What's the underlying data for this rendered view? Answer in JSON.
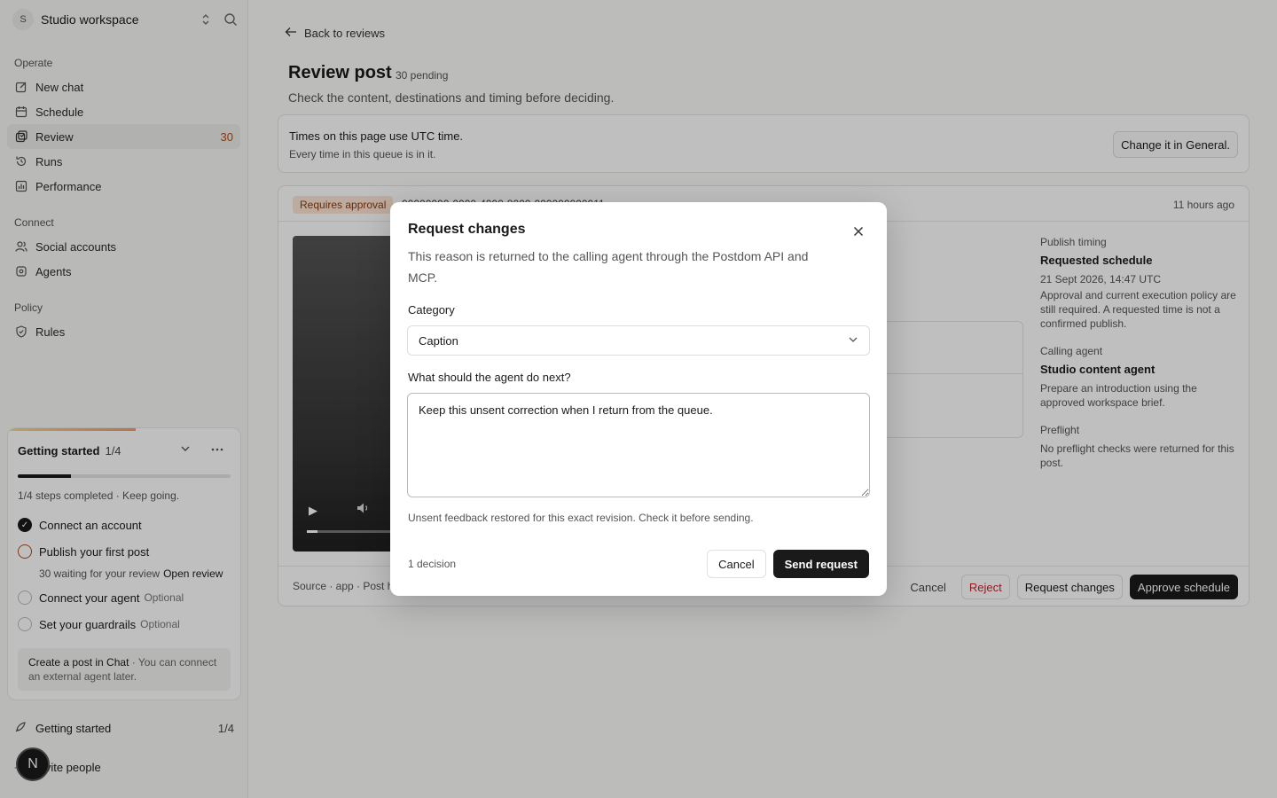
{
  "sidebar": {
    "workspace": {
      "initial": "S",
      "name": "Studio workspace"
    },
    "sections": [
      {
        "label": "Operate",
        "items": [
          {
            "label": "New chat",
            "icon": "pencil-icon"
          },
          {
            "label": "Schedule",
            "icon": "calendar-icon"
          },
          {
            "label": "Review",
            "icon": "review-icon",
            "count": "30",
            "active": true
          },
          {
            "label": "Runs",
            "icon": "history-icon"
          },
          {
            "label": "Performance",
            "icon": "bar-chart-icon"
          }
        ]
      },
      {
        "label": "Connect",
        "items": [
          {
            "label": "Social accounts",
            "icon": "users-icon"
          },
          {
            "label": "Agents",
            "icon": "bot-icon"
          }
        ]
      },
      {
        "label": "Policy",
        "items": [
          {
            "label": "Rules",
            "icon": "shield-icon"
          }
        ]
      }
    ],
    "getting_started": {
      "title": "Getting started",
      "fraction": "1/4",
      "progress": 0.25,
      "subtitle": "1/4 steps completed · Keep going.",
      "steps": [
        {
          "label": "Connect an account",
          "status": "done",
          "optional": ""
        },
        {
          "label": "Publish your first post",
          "status": "current",
          "optional": ""
        },
        {
          "label": "Connect your agent",
          "status": "todo",
          "optional": "Optional"
        },
        {
          "label": "Set your guardrails",
          "status": "todo",
          "optional": "Optional"
        }
      ],
      "waiting_text": "30 waiting for your review",
      "waiting_link": "Open review",
      "hint_strong": "Create a post in Chat",
      "hint_rest": " · You can connect an external agent later."
    },
    "bottom": {
      "getting_started_label": "Getting started",
      "getting_started_count": "1/4",
      "invite_label": "Invite people",
      "avatar_initial": "N"
    }
  },
  "main": {
    "back_label": "Back to reviews",
    "title": "Review post",
    "pending_badge": "30 pending",
    "subtitle": "Check the content, destinations and timing before deciding.",
    "timezone": {
      "title": "Times on this page use UTC time.",
      "sub": "Every time in this queue is in it.",
      "button": "Change it in General."
    },
    "post": {
      "badge": "Requires approval",
      "id": "00000000-0000-4000-8000-000000000011",
      "time": "11 hours ago",
      "publish_timing_label": "Publish timing",
      "publish_timing_title": "Requested schedule",
      "publish_timing_date": "21 Sept 2026, 14:47 UTC",
      "publish_timing_note": "Approval and current execution policy are still required. A requested time is not a confirmed publish.",
      "agent_label": "Calling agent",
      "agent_name": "Studio content agent",
      "agent_note": "Prepare an introduction using the approved workspace brief.",
      "preflight_label": "Preflight",
      "preflight_note": "No preflight checks were returned for this post.",
      "source": "Source · app · Post h",
      "actions": {
        "cancel": "Cancel",
        "reject": "Reject",
        "request": "Request changes",
        "approve": "Approve schedule"
      }
    }
  },
  "modal": {
    "title": "Request changes",
    "description": "This reason is returned to the calling agent through the Postdom API and MCP.",
    "category_label": "Category",
    "category_value": "Caption",
    "next_label": "What should the agent do next?",
    "textarea_value": "Keep this unsent correction when I return from the queue.",
    "hint": "Unsent feedback restored for this exact revision. Check it before sending.",
    "decision": "1 decision",
    "cancel": "Cancel",
    "send": "Send request"
  },
  "colors": {
    "accent": "#1a1a1a",
    "count": "#b14a16",
    "danger": "#c0262b",
    "badge_bg": "#fbe5d3"
  }
}
